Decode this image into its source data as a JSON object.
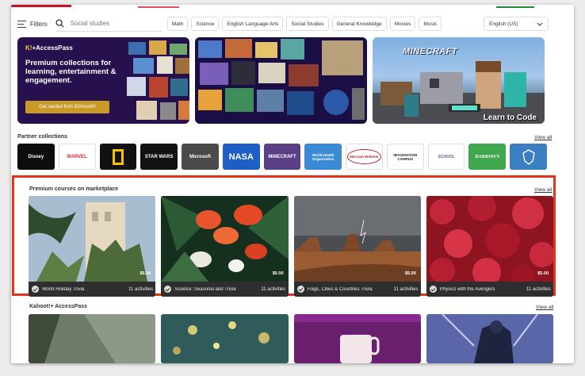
{
  "filters": {
    "label": "Filters",
    "search_placeholder": "Social studies"
  },
  "subjects": [
    "Math",
    "Science",
    "English Language Arts",
    "Social Studies",
    "General Knowledge",
    "Movies",
    "Music"
  ],
  "language": {
    "selected": "English (US)"
  },
  "banners": {
    "accesspass": {
      "brand_prefix": "K!",
      "brand": "+AccessPass",
      "headline": "Premium collections for learning, entertainment & engagement.",
      "cta": "Get started from $3/month!"
    },
    "minecraft": {
      "title": "MINECRAFT",
      "caption": "Learn to Code"
    }
  },
  "partners": {
    "title": "Partner collections",
    "view_all": "View all",
    "items": [
      {
        "name": "Disney",
        "bg": "#0d0d0d",
        "fg": "#ffffff"
      },
      {
        "name": "MARVEL",
        "bg": "#ffffff",
        "fg": "#e62429"
      },
      {
        "name": "National Geographic",
        "bg": "#111111",
        "fg": "#f5c400"
      },
      {
        "name": "STAR WARS",
        "bg": "#111111",
        "fg": "#ffffff"
      },
      {
        "name": "Microsoft",
        "bg": "#4a4a4a",
        "fg": "#ffffff"
      },
      {
        "name": "NASA",
        "bg": "#1d5fc4",
        "fg": "#ffffff"
      },
      {
        "name": "MINECRAFT",
        "bg": "#5a3f86",
        "fg": "#ffffff"
      },
      {
        "name": "World Health Organization",
        "bg": "#3b8ad4",
        "fg": "#ffffff"
      },
      {
        "name": "Merriam-Webster",
        "bg": "#ffffff",
        "fg": "#b5282e"
      },
      {
        "name": "IMAGINATION CAMPUS",
        "bg": "#ffffff",
        "fg": "#222222"
      },
      {
        "name": "SCHOOL",
        "bg": "#ffffff",
        "fg": "#5a6c8a"
      },
      {
        "name": "BARRON'S",
        "bg": "#3fa84f",
        "fg": "#ffffff"
      },
      {
        "name": "Crest",
        "bg": "#3b7fc2",
        "fg": "#ffffff"
      }
    ]
  },
  "premium": {
    "title": "Premium courses on marketplace",
    "view_all": "View all",
    "courses": [
      {
        "name": "World Holiday Trivia",
        "activities": "11 activities",
        "price": "$5.00"
      },
      {
        "name": "Science: Seasonal and Trivia",
        "activities": "11 activities",
        "price": "$5.00"
      },
      {
        "name": "Flags, Cities & Countries Trivia",
        "activities": "11 activities",
        "price": "$5.00"
      },
      {
        "name": "Physics with the Avengers",
        "activities": "11 activities",
        "price": "$5.00"
      }
    ]
  },
  "accesspass_row": {
    "title": "Kahoot!+ AccessPass",
    "view_all": "View all"
  },
  "colors": {
    "highlight": "#e33417",
    "brand_red": "#c4122f",
    "cta_gold": "#c99a28"
  }
}
